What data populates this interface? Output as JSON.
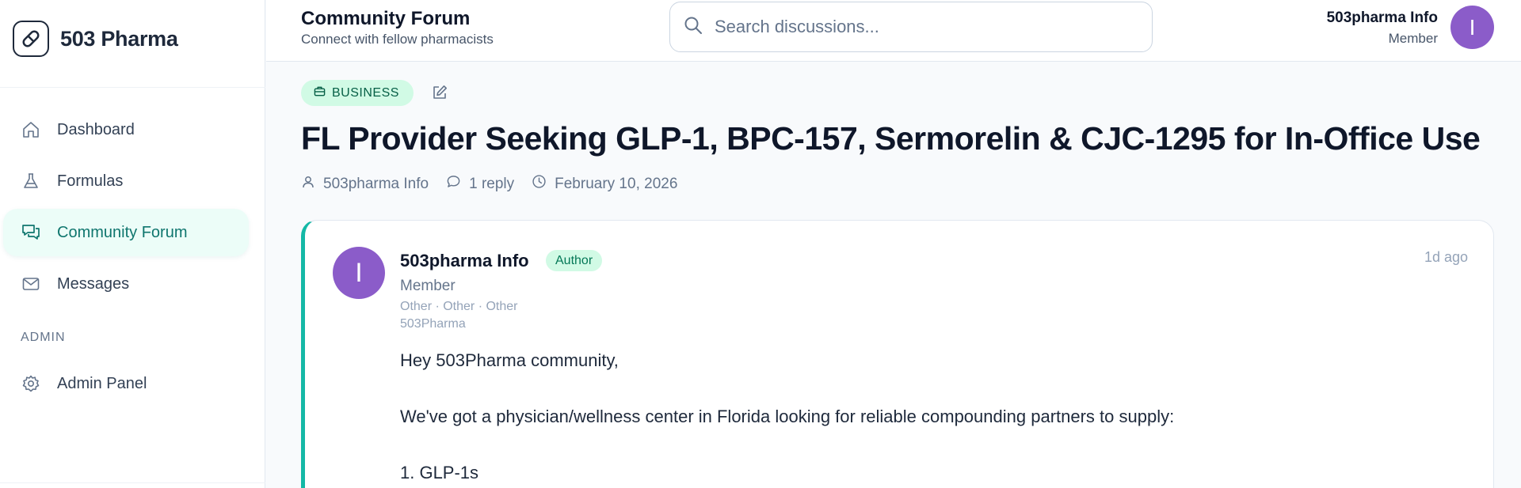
{
  "brand": {
    "name": "503 Pharma"
  },
  "sidebar": {
    "items": [
      {
        "label": "Dashboard",
        "icon": "home-icon"
      },
      {
        "label": "Formulas",
        "icon": "flask-icon"
      },
      {
        "label": "Community Forum",
        "icon": "chat-icon",
        "active": true
      },
      {
        "label": "Messages",
        "icon": "mail-icon"
      }
    ],
    "section_label": "ADMIN",
    "admin_items": [
      {
        "label": "Admin Panel",
        "icon": "gear-icon"
      }
    ]
  },
  "header": {
    "title": "Community Forum",
    "subtitle": "Connect with fellow pharmacists",
    "search_placeholder": "Search discussions...",
    "user_name": "503pharma Info",
    "user_role": "Member",
    "avatar_initial": "I"
  },
  "post": {
    "category": "BUSINESS",
    "title": "FL Provider Seeking GLP-1, BPC-157, Sermorelin & CJC-1295 for In-Office Use",
    "meta": {
      "author": "503pharma Info",
      "replies": "1 reply",
      "date": "February 10, 2026"
    },
    "card": {
      "avatar_initial": "I",
      "author": "503pharma Info",
      "badge": "Author",
      "role": "Member",
      "tags": "Other · Other · Other",
      "org": "503Pharma",
      "time": "1d ago",
      "body": [
        "Hey 503Pharma community,",
        "We've got a physician/wellness center in Florida looking for reliable compounding partners to supply:",
        "1. GLP-1s"
      ]
    }
  },
  "colors": {
    "accent": "#14b8a6",
    "active_bg": "#ecfdf8",
    "avatar": "#8b5cc9",
    "badge_bg": "#d1fae5"
  }
}
